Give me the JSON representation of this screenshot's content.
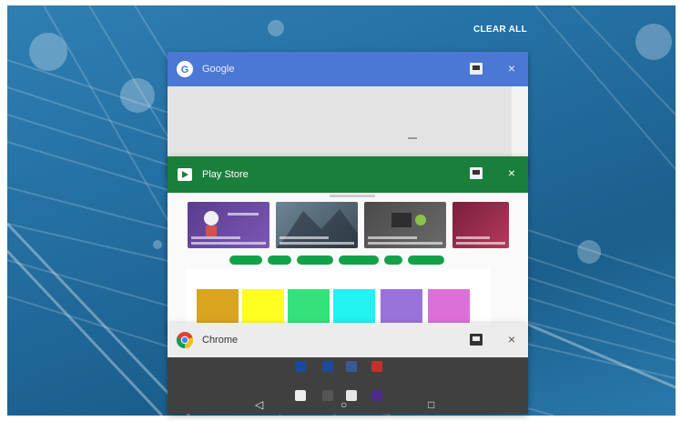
{
  "header": {
    "clear_all": "CLEAR ALL"
  },
  "cards": {
    "google": {
      "title": "Google",
      "accent": "#4a78d4"
    },
    "play": {
      "title": "Play Store",
      "accent": "#1a7f3b"
    },
    "chrome": {
      "title": "Chrome",
      "accent": "#ececec"
    }
  },
  "icons": {
    "close": "×",
    "split": "split-screen-icon"
  },
  "nav": {
    "back": "◁",
    "home": "○",
    "recents": "□"
  }
}
